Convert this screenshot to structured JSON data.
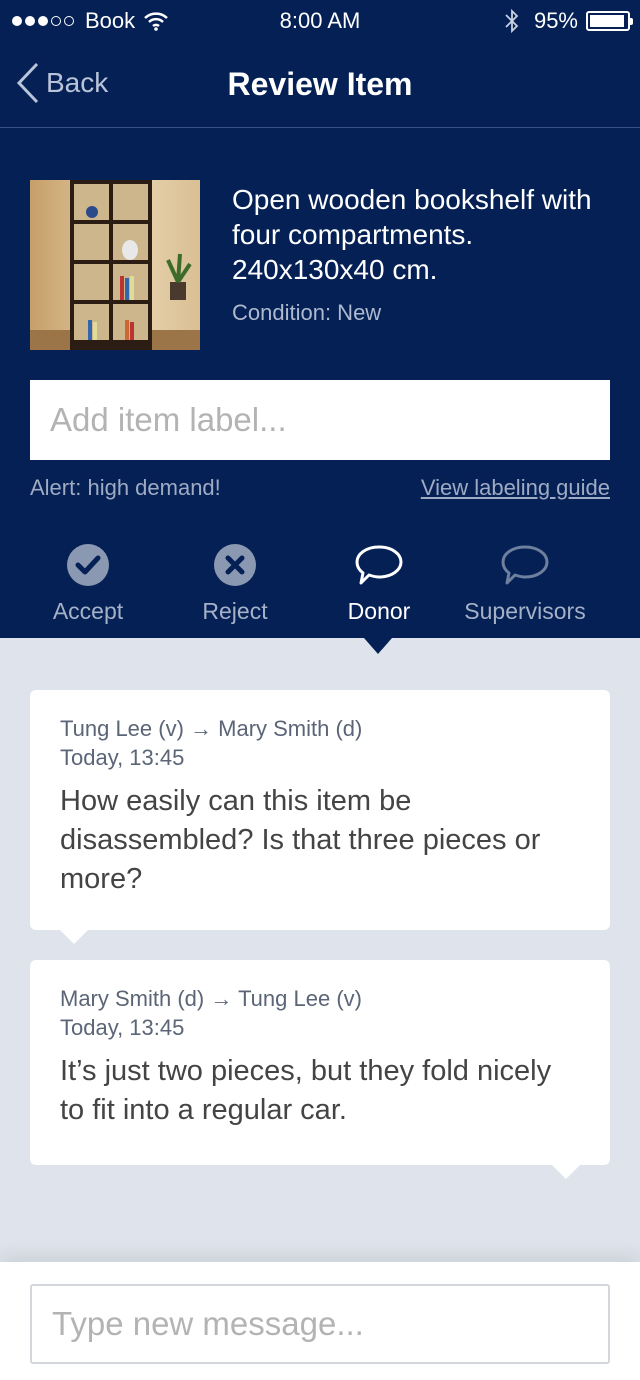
{
  "status_bar": {
    "carrier": "Book",
    "time": "8:00 AM",
    "battery": "95%",
    "battery_level": 0.95,
    "signal_bars": 3
  },
  "nav": {
    "back_label": "Back",
    "title": "Review Item"
  },
  "item": {
    "description": "Open wooden bookshelf with four compartments. 240x130x40 cm.",
    "condition": "Condition: New",
    "image_icon": "bookshelf-photo"
  },
  "label_input": {
    "placeholder": "Add item label...",
    "value": ""
  },
  "alert_text": "Alert: high demand!",
  "guide_link": "View labeling guide",
  "tabs": [
    {
      "label": "Accept",
      "icon": "check-circle-icon",
      "active": false
    },
    {
      "label": "Reject",
      "icon": "x-circle-icon",
      "active": false
    },
    {
      "label": "Donor",
      "icon": "chat-bubble-icon",
      "active": true
    },
    {
      "label": "Supervisors",
      "icon": "chat-bubble-icon",
      "active": false
    }
  ],
  "messages": [
    {
      "from_to": "Tung Lee (v) → Mary Smith (d)",
      "time": "Today, 13:45",
      "text": "How easily can this item be disassembled? Is that three pieces or more?"
    },
    {
      "from_to": "Mary Smith (d) → Tung Lee (v)",
      "time": "Today, 13:45",
      "text": "It’s just two pieces, but they fold nicely to fit into a regular car."
    }
  ],
  "compose": {
    "placeholder": "Type new message...",
    "value": ""
  },
  "colors": {
    "header_bg": "#042055",
    "content_bg": "#dfe4ec",
    "icon_inactive": "#8b98b2"
  }
}
